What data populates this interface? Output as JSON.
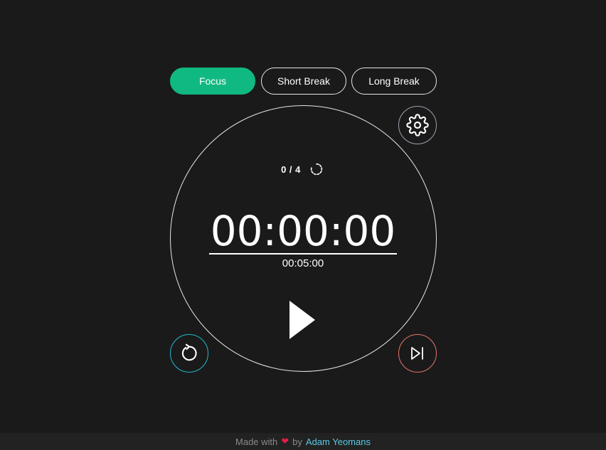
{
  "tabs": [
    {
      "label": "Focus",
      "active": true
    },
    {
      "label": "Short Break",
      "active": false
    },
    {
      "label": "Long Break",
      "active": false
    }
  ],
  "session": {
    "count": "0 / 4"
  },
  "timer": {
    "elapsed": "00:00:00",
    "target": "00:05:00"
  },
  "icons": {
    "settings": "gear-icon",
    "session_reset": "refresh-icon",
    "play": "play-icon",
    "reset": "reset-icon",
    "skip": "skip-next-icon",
    "heart": "heart-icon"
  },
  "footer": {
    "made_with": "Made with",
    "by": "by",
    "author": "Adam Yeomans"
  },
  "colors": {
    "background": "#1a1a1a",
    "accent": "#10b981",
    "reset_ring": "#22b8cf",
    "skip_ring": "#e5736b",
    "link": "#5cc8e6",
    "heart": "#e11d48"
  }
}
